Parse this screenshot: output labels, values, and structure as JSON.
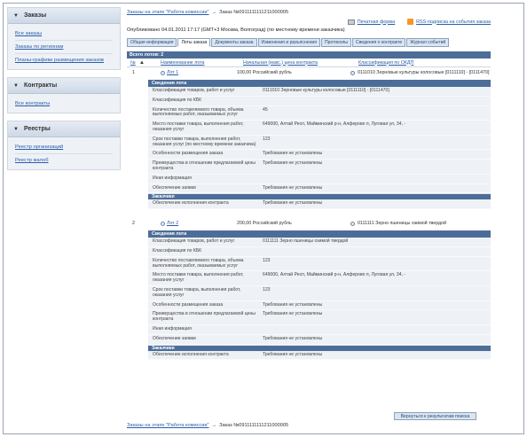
{
  "sidebar": {
    "orders": {
      "title": "Заказы",
      "links": [
        "Все заказы",
        "Заказы по регионам",
        "Планы-графики размещения заказов"
      ]
    },
    "contracts": {
      "title": "Контракты",
      "links": [
        "Все контракты"
      ]
    },
    "registries": {
      "title": "Реестры",
      "links": [
        "Реестр организаций",
        "Реестр жалоб"
      ]
    }
  },
  "breadcrumb": {
    "parent": "Заказы на этапе \"Работа комиссии\"",
    "current": "Заказ №0911111111211000005"
  },
  "toplinks": {
    "print": "Печатная форма",
    "rss": "RSS-подписка на события заказа"
  },
  "published": "Опубликовано 04.01.2011 17:17 (GMT+3 Москва, Волгоград) (по местному времени заказчика)",
  "tabs": [
    {
      "label": "Общая информация",
      "active": false
    },
    {
      "label": "Лоты заказа",
      "active": true
    },
    {
      "label": "Документы заказа",
      "active": false
    },
    {
      "label": "Изменения и разъяснения",
      "active": false
    },
    {
      "label": "Протоколы",
      "active": false
    },
    {
      "label": "Сведения о контракте",
      "active": false
    },
    {
      "label": "Журнал событий",
      "active": false
    }
  ],
  "total": "Всего лотов: 2",
  "columns": {
    "no": "№",
    "name": "Наименование лота",
    "price": "Начальная (макс.) цена контракта",
    "okdp": "Классификация по ОКДП"
  },
  "lots": [
    {
      "no": "1",
      "name": "Лот 1",
      "price": "100,00 Российский рубль",
      "okdp": "0111010 Зерновые культуры колосовые [0111110] - [0111470]",
      "section_title": "Сведения лота",
      "details": [
        {
          "k": "Классификация товаров, работ и услуг",
          "v": "0111010 Зерновые культуры колосовые [0111110] - [0111470]"
        },
        {
          "k": "Классификация по КБК",
          "v": ""
        },
        {
          "k": "Количество поставляемого товара, объема выполняемых работ, оказываемых услуг",
          "v": "45"
        },
        {
          "k": "Место поставки товара, выполнения работ, оказания услуг",
          "v": "649000, Алтай Респ, Майминский р-н, Алферово п, Луговая ул, 34, -"
        },
        {
          "k": "Срок поставки товара, выполнения работ, оказания услуг (по местному времени заказчика)",
          "v": "123"
        },
        {
          "k": "Особенности размещения заказа",
          "v": "Требования не установлены"
        },
        {
          "k": "Преимущества в отношении предлагаемой цены контракта",
          "v": "Требования не установлены"
        },
        {
          "k": "Иная информация",
          "v": ""
        },
        {
          "k": "Обеспечение заявки",
          "v": "Требования не установлены"
        }
      ],
      "customers_title": "Заказчики",
      "customers": [
        {
          "k": "Обеспечение исполнения контракта",
          "v": "Требования не установлены"
        }
      ]
    },
    {
      "no": "2",
      "name": "Лот 2",
      "price": "200,00 Российский рубль",
      "okdp": "0111111 Зерно пшеницы озимой твердой",
      "section_title": "Сведения лота",
      "details": [
        {
          "k": "Классификация товаров, работ и услуг",
          "v": "0111111 Зерно пшеницы озимой твердой"
        },
        {
          "k": "Классификация по КБК",
          "v": ""
        },
        {
          "k": "Количество поставляемого товара, объема выполняемых работ, оказываемых услуг",
          "v": "123"
        },
        {
          "k": "Место поставки товара, выполнения работ, оказания услуг",
          "v": "649000, Алтай Респ, Майминский р-н, Алферово п, Луговая ул, 34, -"
        },
        {
          "k": "Срок поставки товара, выполнения работ, оказания услуг",
          "v": "123"
        },
        {
          "k": "Особенности размещения заказа",
          "v": "Требования не установлены"
        },
        {
          "k": "Преимущества в отношении предлагаемой цены контракта",
          "v": "Требования не установлены"
        },
        {
          "k": "Иная информация",
          "v": ""
        },
        {
          "k": "Обеспечение заявки",
          "v": "Требования не установлены"
        }
      ],
      "customers_title": "Заказчики",
      "customers": [
        {
          "k": "Обеспечение исполнения контракта",
          "v": "Требования не установлены"
        }
      ]
    }
  ],
  "return_button": "Вернуться к результатам поиска"
}
